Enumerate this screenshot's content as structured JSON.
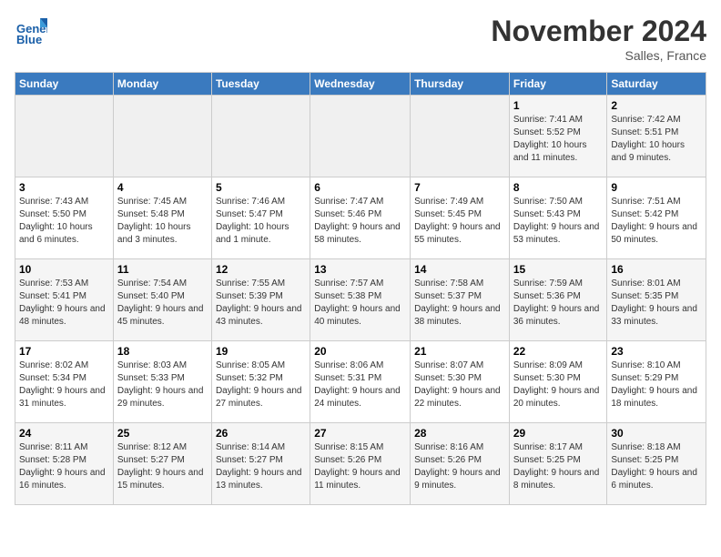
{
  "header": {
    "logo_text": "General Blue",
    "month": "November 2024",
    "location": "Salles, France"
  },
  "weekdays": [
    "Sunday",
    "Monday",
    "Tuesday",
    "Wednesday",
    "Thursday",
    "Friday",
    "Saturday"
  ],
  "weeks": [
    [
      {
        "day": "",
        "info": ""
      },
      {
        "day": "",
        "info": ""
      },
      {
        "day": "",
        "info": ""
      },
      {
        "day": "",
        "info": ""
      },
      {
        "day": "",
        "info": ""
      },
      {
        "day": "1",
        "info": "Sunrise: 7:41 AM\nSunset: 5:52 PM\nDaylight: 10 hours and 11 minutes."
      },
      {
        "day": "2",
        "info": "Sunrise: 7:42 AM\nSunset: 5:51 PM\nDaylight: 10 hours and 9 minutes."
      }
    ],
    [
      {
        "day": "3",
        "info": "Sunrise: 7:43 AM\nSunset: 5:50 PM\nDaylight: 10 hours and 6 minutes."
      },
      {
        "day": "4",
        "info": "Sunrise: 7:45 AM\nSunset: 5:48 PM\nDaylight: 10 hours and 3 minutes."
      },
      {
        "day": "5",
        "info": "Sunrise: 7:46 AM\nSunset: 5:47 PM\nDaylight: 10 hours and 1 minute."
      },
      {
        "day": "6",
        "info": "Sunrise: 7:47 AM\nSunset: 5:46 PM\nDaylight: 9 hours and 58 minutes."
      },
      {
        "day": "7",
        "info": "Sunrise: 7:49 AM\nSunset: 5:45 PM\nDaylight: 9 hours and 55 minutes."
      },
      {
        "day": "8",
        "info": "Sunrise: 7:50 AM\nSunset: 5:43 PM\nDaylight: 9 hours and 53 minutes."
      },
      {
        "day": "9",
        "info": "Sunrise: 7:51 AM\nSunset: 5:42 PM\nDaylight: 9 hours and 50 minutes."
      }
    ],
    [
      {
        "day": "10",
        "info": "Sunrise: 7:53 AM\nSunset: 5:41 PM\nDaylight: 9 hours and 48 minutes."
      },
      {
        "day": "11",
        "info": "Sunrise: 7:54 AM\nSunset: 5:40 PM\nDaylight: 9 hours and 45 minutes."
      },
      {
        "day": "12",
        "info": "Sunrise: 7:55 AM\nSunset: 5:39 PM\nDaylight: 9 hours and 43 minutes."
      },
      {
        "day": "13",
        "info": "Sunrise: 7:57 AM\nSunset: 5:38 PM\nDaylight: 9 hours and 40 minutes."
      },
      {
        "day": "14",
        "info": "Sunrise: 7:58 AM\nSunset: 5:37 PM\nDaylight: 9 hours and 38 minutes."
      },
      {
        "day": "15",
        "info": "Sunrise: 7:59 AM\nSunset: 5:36 PM\nDaylight: 9 hours and 36 minutes."
      },
      {
        "day": "16",
        "info": "Sunrise: 8:01 AM\nSunset: 5:35 PM\nDaylight: 9 hours and 33 minutes."
      }
    ],
    [
      {
        "day": "17",
        "info": "Sunrise: 8:02 AM\nSunset: 5:34 PM\nDaylight: 9 hours and 31 minutes."
      },
      {
        "day": "18",
        "info": "Sunrise: 8:03 AM\nSunset: 5:33 PM\nDaylight: 9 hours and 29 minutes."
      },
      {
        "day": "19",
        "info": "Sunrise: 8:05 AM\nSunset: 5:32 PM\nDaylight: 9 hours and 27 minutes."
      },
      {
        "day": "20",
        "info": "Sunrise: 8:06 AM\nSunset: 5:31 PM\nDaylight: 9 hours and 24 minutes."
      },
      {
        "day": "21",
        "info": "Sunrise: 8:07 AM\nSunset: 5:30 PM\nDaylight: 9 hours and 22 minutes."
      },
      {
        "day": "22",
        "info": "Sunrise: 8:09 AM\nSunset: 5:30 PM\nDaylight: 9 hours and 20 minutes."
      },
      {
        "day": "23",
        "info": "Sunrise: 8:10 AM\nSunset: 5:29 PM\nDaylight: 9 hours and 18 minutes."
      }
    ],
    [
      {
        "day": "24",
        "info": "Sunrise: 8:11 AM\nSunset: 5:28 PM\nDaylight: 9 hours and 16 minutes."
      },
      {
        "day": "25",
        "info": "Sunrise: 8:12 AM\nSunset: 5:27 PM\nDaylight: 9 hours and 15 minutes."
      },
      {
        "day": "26",
        "info": "Sunrise: 8:14 AM\nSunset: 5:27 PM\nDaylight: 9 hours and 13 minutes."
      },
      {
        "day": "27",
        "info": "Sunrise: 8:15 AM\nSunset: 5:26 PM\nDaylight: 9 hours and 11 minutes."
      },
      {
        "day": "28",
        "info": "Sunrise: 8:16 AM\nSunset: 5:26 PM\nDaylight: 9 hours and 9 minutes."
      },
      {
        "day": "29",
        "info": "Sunrise: 8:17 AM\nSunset: 5:25 PM\nDaylight: 9 hours and 8 minutes."
      },
      {
        "day": "30",
        "info": "Sunrise: 8:18 AM\nSunset: 5:25 PM\nDaylight: 9 hours and 6 minutes."
      }
    ]
  ]
}
